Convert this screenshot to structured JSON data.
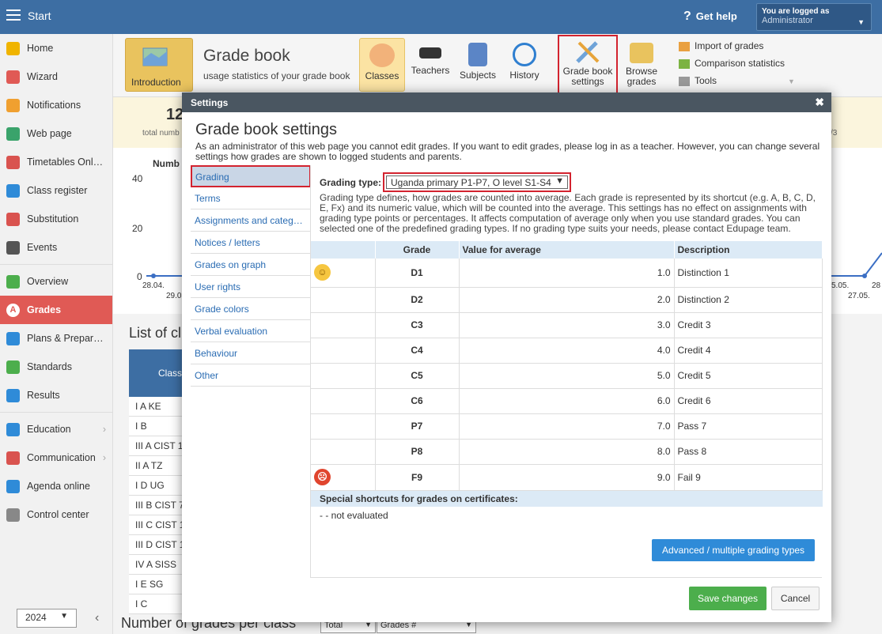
{
  "topbar": {
    "start": "Start",
    "help": "Get help",
    "logged_title": "You are logged as",
    "logged_user": "Administrator"
  },
  "sidebar": {
    "items": [
      {
        "label": "Home",
        "icon": "star-icon",
        "color": "#f0b400"
      },
      {
        "label": "Wizard",
        "icon": "wand-icon",
        "color": "#e05a55"
      },
      {
        "label": "Notifications",
        "icon": "envelope-icon",
        "color": "#f0a030"
      },
      {
        "label": "Web page",
        "icon": "web-page-icon",
        "color": "#3aa36b"
      },
      {
        "label": "Timetables Onl…",
        "icon": "timetable-icon",
        "color": "#d9534f"
      },
      {
        "label": "Class register",
        "icon": "class-register-icon",
        "color": "#2f8bd8"
      },
      {
        "label": "Substitution",
        "icon": "substitution-icon",
        "color": "#d9534f"
      },
      {
        "label": "Events",
        "icon": "calendar-icon",
        "color": "#555555"
      },
      {
        "label": "Overview",
        "icon": "check-icon",
        "color": "#4cae4c"
      },
      {
        "label": "Grades",
        "icon": "grades-icon",
        "color": "#ffffff"
      },
      {
        "label": "Plans & Prepar…",
        "icon": "plans-icon",
        "color": "#2f8bd8"
      },
      {
        "label": "Standards",
        "icon": "shield-icon",
        "color": "#4cae4c"
      },
      {
        "label": "Results",
        "icon": "results-icon",
        "color": "#2f8bd8"
      },
      {
        "label": "Education",
        "icon": "education-icon",
        "color": "#2f8bd8"
      },
      {
        "label": "Communication",
        "icon": "communication-icon",
        "color": "#d9534f"
      },
      {
        "label": "Agenda online",
        "icon": "agenda-icon",
        "color": "#2f8bd8"
      },
      {
        "label": "Control center",
        "icon": "gear-icon",
        "color": "#888888"
      }
    ],
    "year": "2024"
  },
  "toolbar": {
    "intro": "Introduction",
    "title": "Grade book",
    "subtitle": "usage statistics of your grade book",
    "buttons": [
      "Classes",
      "Teachers",
      "Subjects",
      "History",
      "Grade book settings",
      "Browse grades"
    ],
    "links": [
      "Import of grades",
      "Comparison statistics",
      "Tools"
    ]
  },
  "background": {
    "stat_num": "12",
    "stat_label": "total numb",
    "chart_title": "Numb",
    "y40": "40",
    "y20": "20",
    "y0": "0",
    "d1": "28.04.",
    "d2": "29.0",
    "d3": "5.05.",
    "d4": "27.05.",
    "d5": "28",
    "list_title": "List of cl",
    "class_head": "Class",
    "classes": [
      "I A KE",
      "I B",
      "III A CIST 1",
      "II A TZ",
      "I D UG",
      "III B CIST 7",
      "III C CIST 1",
      "III D CIST 1",
      "IV A SISS",
      "I E SG",
      "I C"
    ],
    "num_grades": "Number of grades per class",
    "sel1": "Total",
    "sel2": "Grades #",
    "right3": "/3"
  },
  "modal": {
    "header": "Settings",
    "title": "Grade book settings",
    "description": "As an administrator of this web page you cannot edit grades. If you want to edit grades, please log in as a teacher. However, you can change several settings how grades are shown to logged students and parents.",
    "tabs": [
      "Grading",
      "Terms",
      "Assignments and categ…",
      "Notices / letters",
      "Grades on graph",
      "User rights",
      "Grade colors",
      "Verbal evaluation",
      "Behaviour",
      "Other"
    ],
    "grading_type_label": "Grading type:",
    "grading_type_value": "Uganda primary P1-P7, O level S1-S4",
    "grading_desc": "Grading type defines, how grades are counted into average. Each grade is represented by its shortcut (e.g. A, B, C, D, E, Fx) and its numeric value, which will be counted into the average. This settings has no effect on assignments with grading type points or percentages. It affects computation of average only when you use standard grades. You can selected one of the predefined grading types. If no grading type suits your needs, please contact Edupage team.",
    "columns": [
      "Grade",
      "Value for average",
      "Description"
    ],
    "rows": [
      {
        "grade": "D1",
        "value": "1.0",
        "desc": "Distinction 1",
        "icon": "happy"
      },
      {
        "grade": "D2",
        "value": "2.0",
        "desc": "Distinction 2",
        "icon": ""
      },
      {
        "grade": "C3",
        "value": "3.0",
        "desc": "Credit 3",
        "icon": ""
      },
      {
        "grade": "C4",
        "value": "4.0",
        "desc": "Credit 4",
        "icon": ""
      },
      {
        "grade": "C5",
        "value": "5.0",
        "desc": "Credit 5",
        "icon": ""
      },
      {
        "grade": "C6",
        "value": "6.0",
        "desc": "Credit 6",
        "icon": ""
      },
      {
        "grade": "P7",
        "value": "7.0",
        "desc": "Pass 7",
        "icon": ""
      },
      {
        "grade": "P8",
        "value": "8.0",
        "desc": "Pass 8",
        "icon": ""
      },
      {
        "grade": "F9",
        "value": "9.0",
        "desc": "Fail 9",
        "icon": "angry"
      }
    ],
    "special_title": "Special shortcuts for grades on certificates:",
    "special_value": "- - not evaluated",
    "advanced_btn": "Advanced / multiple grading types",
    "save_btn": "Save changes",
    "cancel_btn": "Cancel"
  }
}
